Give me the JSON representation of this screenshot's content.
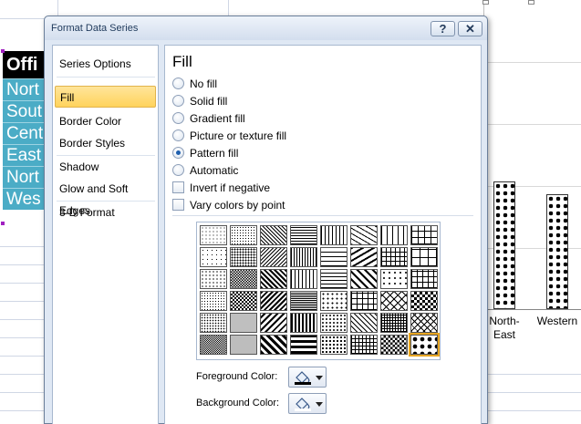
{
  "dialog": {
    "title": "Format Data Series",
    "help_button": "?",
    "close_button": "✕"
  },
  "nav": {
    "items": [
      {
        "label": "Series Options",
        "selected": false
      },
      {
        "label": "Fill",
        "selected": true
      },
      {
        "label": "Border Color",
        "selected": false
      },
      {
        "label": "Border Styles",
        "selected": false
      },
      {
        "label": "Shadow",
        "selected": false
      },
      {
        "label": "Glow and Soft Edges",
        "selected": false
      },
      {
        "label": "3-D Format",
        "selected": false
      }
    ]
  },
  "fill": {
    "section_title": "Fill",
    "options": [
      {
        "label": "No fill",
        "type": "radio",
        "checked": false
      },
      {
        "label": "Solid fill",
        "type": "radio",
        "checked": false
      },
      {
        "label": "Gradient fill",
        "type": "radio",
        "checked": false
      },
      {
        "label": "Picture or texture fill",
        "type": "radio",
        "checked": false
      },
      {
        "label": "Pattern fill",
        "type": "radio",
        "checked": true
      },
      {
        "label": "Automatic",
        "type": "radio",
        "checked": false
      },
      {
        "label": "Invert if negative",
        "type": "checkbox",
        "checked": false
      },
      {
        "label": "Vary colors by point",
        "type": "checkbox",
        "checked": false
      }
    ],
    "pattern_grid": {
      "rows": 6,
      "columns": 8,
      "selected_index": 47
    },
    "foreground_color_label": "Foreground Color:",
    "background_color_label": "Background Color:",
    "foreground_color": "#000000",
    "background_color": "#ffffff"
  },
  "worksheet": {
    "table_header": "Offi",
    "table_rows": [
      "Nort",
      "Sout",
      "Cent",
      "East",
      "Nort",
      "Wes"
    ],
    "header_bg": "#000000",
    "cell_bg": "#4bacc6"
  },
  "chart": {
    "categories": [
      "North-East",
      "Western"
    ],
    "category_display": [
      "North-\nEast",
      "Western"
    ],
    "values": [
      100,
      90
    ]
  },
  "colors": {
    "selection_highlight": "#ffd35c",
    "radio_dot": "#1f5fae"
  }
}
